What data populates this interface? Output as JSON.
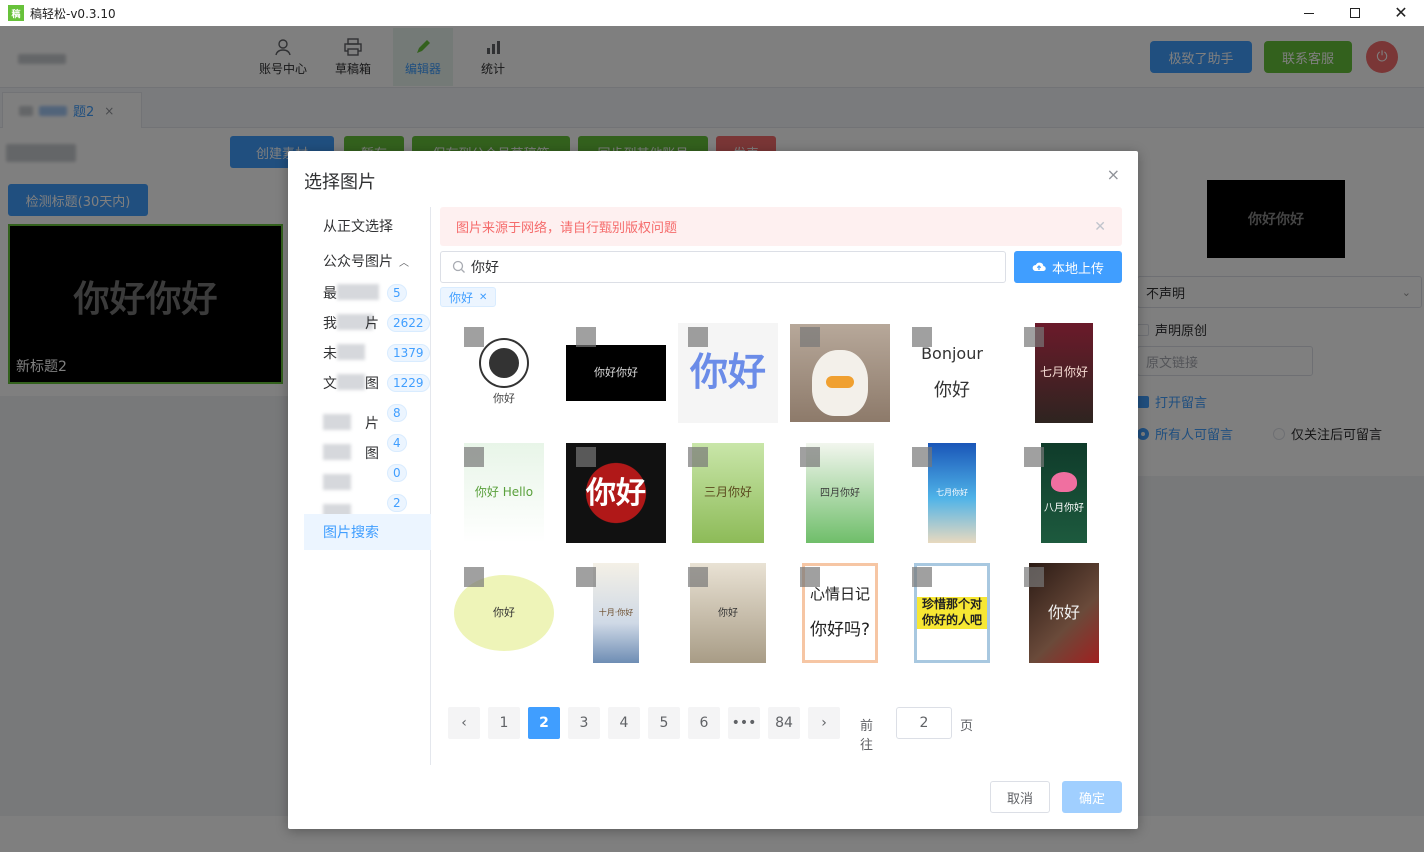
{
  "window": {
    "title": "稿轻松-v0.3.10",
    "logo_text": "稿"
  },
  "nav": {
    "items": [
      {
        "label": "账号中心",
        "icon": "user-icon"
      },
      {
        "label": "草稿箱",
        "icon": "printer-icon"
      },
      {
        "label": "编辑器",
        "icon": "pencil-icon",
        "active": true
      },
      {
        "label": "统计",
        "icon": "bar-chart-icon"
      }
    ],
    "assistant_label": "极致了助手",
    "service_label": "联系客服"
  },
  "doc_tab": {
    "label": "题2",
    "close": "×"
  },
  "toolbar": {
    "create_label": "创建素材",
    "save_label": "暂存",
    "save_draft_label": "保存到公众号草稿箱",
    "sync_label": "同步到其他账号",
    "publish_label": "发表"
  },
  "left_panel": {
    "detect_label": "检测标题(30天内)",
    "cover_text": "你好你好",
    "cover_title": "新标题2"
  },
  "right_panel": {
    "thumb_text": "你好你好",
    "declare_value": "不声明",
    "original_label": "声明原创",
    "link_placeholder": "原文链接",
    "open_comment_label": "打开留言",
    "comment_all_label": "所有人可留言",
    "comment_follow_label": "仅关注后可留言"
  },
  "dialog": {
    "title": "选择图片",
    "close": "×",
    "menu": {
      "from_body": "从正文选择",
      "wechat_images": "公众号图片",
      "sub_items": [
        {
          "prefix": "最",
          "suffix": "",
          "count": "5"
        },
        {
          "prefix": "我",
          "suffix": "片",
          "count": "2622"
        },
        {
          "prefix": "未",
          "suffix": "",
          "count": "1379"
        },
        {
          "prefix": "文",
          "suffix": "图",
          "count": "1229"
        },
        {
          "prefix": "",
          "suffix": "片",
          "count": "8"
        },
        {
          "prefix": "",
          "suffix": "图",
          "count": "4"
        },
        {
          "prefix": "",
          "suffix": "",
          "count": "0"
        },
        {
          "prefix": "",
          "suffix": "",
          "count": "2"
        }
      ],
      "image_search": "图片搜索"
    },
    "warning": "图片来源于网络，请自行甄别版权问题",
    "search_value": "你好",
    "upload_label": "本地上传",
    "tag_label": "你好",
    "images": [
      {
        "name": "penguin-hello",
        "text": "你好"
      },
      {
        "name": "black-nihao",
        "text": "你好你好"
      },
      {
        "name": "blue-nihao-text",
        "text": "你好"
      },
      {
        "name": "duck-photo",
        "text": ""
      },
      {
        "name": "bonjour-nihao",
        "text": "Bonjour",
        "text2": "你好"
      },
      {
        "name": "july-hello-poster",
        "text": "七月你好"
      },
      {
        "name": "hello-kids-cover",
        "text": "你好 Hello"
      },
      {
        "name": "2021-hello",
        "text": "你好"
      },
      {
        "name": "march-hello",
        "text": "三月你好"
      },
      {
        "name": "april-hello",
        "text": "四月你好"
      },
      {
        "name": "july-beach",
        "text": "七月你好"
      },
      {
        "name": "august-lotus",
        "text": "八月你好"
      },
      {
        "name": "cartoon-couple",
        "text": "你好"
      },
      {
        "name": "october-hello",
        "text": "十月·你好"
      },
      {
        "name": "book-photo",
        "text": "你好"
      },
      {
        "name": "mood-diary",
        "text": "心情日记",
        "text2": "你好吗?"
      },
      {
        "name": "memory-card",
        "text": "珍惜那个对你好的人吧"
      },
      {
        "name": "calligraphy-roses",
        "text": "你好"
      }
    ],
    "pager": {
      "prev": "‹",
      "pages": [
        "1",
        "2",
        "3",
        "4",
        "5",
        "6",
        "•••",
        "84"
      ],
      "active_page": "2",
      "next": "›",
      "goto_label": "前往",
      "goto_value": "2",
      "page_unit": "页"
    },
    "cancel_label": "取消",
    "ok_label": "确定"
  },
  "colors": {
    "primary": "#409eff",
    "success": "#67c23a",
    "danger": "#f56c6c"
  }
}
